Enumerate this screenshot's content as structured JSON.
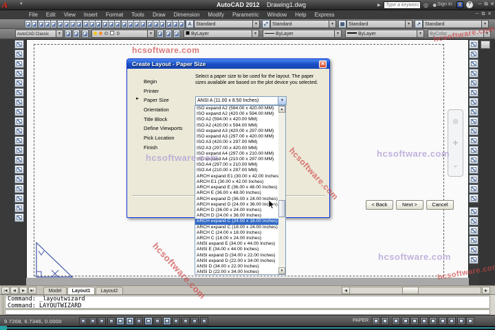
{
  "titlebar": {
    "app": "AutoCAD 2012",
    "doc": "Drawing1.dwg",
    "search_placeholder": "Type a keyword or phrase",
    "sign_in": "Sign In",
    "exchange_glyph": "X",
    "help_glyph": "?"
  },
  "menus": [
    "File",
    "Edit",
    "View",
    "Insert",
    "Format",
    "Tools",
    "Draw",
    "Dimension",
    "Modify",
    "Parametric",
    "Window",
    "Help",
    "Express"
  ],
  "toolbar_row1": {
    "icons": [
      "qnew",
      "open",
      "qsave",
      "plot",
      "plot-preview",
      "publish",
      "3d-print",
      "cut",
      "copy",
      "paste",
      "match-properties",
      "block-editor",
      "undo",
      "undo-list",
      "redo",
      "redo-list",
      "pan-realtime",
      "zoom-realtime",
      "zoom-window",
      "zoom-previous",
      "properties",
      "design-center",
      "tool-palettes",
      "sheet-set-manager",
      "markup-set-manager",
      "quick-calc",
      "help"
    ],
    "style_combos": [
      {
        "name": "text-style",
        "value": "Standard",
        "glyph": "A"
      },
      {
        "name": "dimension-style",
        "value": "Standard",
        "glyph": "⤢"
      },
      {
        "name": "table-style",
        "value": "Standard",
        "glyph": "▦"
      },
      {
        "name": "multileader-style",
        "value": "Standard",
        "glyph": "↗"
      }
    ]
  },
  "toolbar_row2": {
    "workspace": "AutoCAD Classic",
    "workspace_buttons": [
      "workspace-settings",
      "my-workspace"
    ],
    "layer_buttons": [
      "layer-properties-manager"
    ],
    "layer_combo": {
      "name": "0"
    },
    "layer_tool_buttons": [
      "make-object-layer-current",
      "layer-previous",
      "layer-states"
    ],
    "color": "ByLayer",
    "linetype": "ByLayer",
    "lineweight": "ByLayer",
    "plot_style": "ByColor"
  },
  "draw_toolbar": [
    "line",
    "construction-line",
    "polyline",
    "polygon",
    "rectangle",
    "arc",
    "circle",
    "revision-cloud",
    "spline",
    "ellipse",
    "ellipse-arc",
    "insert-block",
    "make-block",
    "point",
    "hatch",
    "gradient",
    "region",
    "table",
    "multiline-text"
  ],
  "modify_toolbar": [
    "erase",
    "copy",
    "mirror",
    "offset",
    "array",
    "move",
    "rotate",
    "scale",
    "stretch",
    "trim",
    "extend",
    "break-at-point",
    "break",
    "join",
    "chamfer",
    "fillet",
    "explode"
  ],
  "draworder_toolbar": [
    "bring-to-front",
    "send-to-back",
    "bring-above-objects",
    "send-under-objects",
    "text-to-front",
    "hatch-to-back"
  ],
  "navbar_icons": [
    "steering-wheel",
    "pan-hand",
    "zoom-extents"
  ],
  "dialog": {
    "title": "Create Layout - Paper Size",
    "close_glyph": "✕",
    "steps": [
      "Begin",
      "Printer",
      "Paper Size",
      "Orientation",
      "Title Block",
      "Define Viewports",
      "Pick Location",
      "Finish"
    ],
    "active_step": "Paper Size",
    "hint_line1": "Select a paper size to be used for the layout.  The paper",
    "hint_line2": "sizes available are based on the plot device you selected.",
    "combo_value": "ANSI A (11.00 x 8.50 Inches)",
    "paper_sizes": [
      "ISO expand A2 (594.00 x 420.00 MM)",
      "ISO expand A2 (420.00 x 594.00 MM)",
      "ISO A2 (594.00 x 420.00 MM)",
      "ISO A2 (420.00 x 594.00 MM)",
      "ISO expand A3 (420.00 x 297.00 MM)",
      "ISO expand A3 (297.00 x 420.00 MM)",
      "ISO A3 (420.00 x 297.00 MM)",
      "ISO A3 (297.00 x 420.00 MM)",
      "ISO expand A4 (297.00 x 210.00 MM)",
      "ISO expand A4 (210.00 x 297.00 MM)",
      "ISO A4 (297.00 x 210.00 MM)",
      "ISO A4 (210.00 x 297.00 MM)",
      "ARCH expand E1 (30.00 x 42.00 Inches)",
      "ARCH E1 (30.00 x 42.00 Inches)",
      "ARCH expand E (36.00 x 48.00 Inches)",
      "ARCH E (36.00 x 48.00 Inches)",
      "ARCH expand D (36.00 x 24.00 Inches)",
      "ARCH expand D (24.00 x 36.00 Inches)",
      "ARCH D (36.00 x 24.00 Inches)",
      "ARCH D (24.00 x 36.00 Inches)",
      "ARCH expand C (24.00 x 18.00 Inches)",
      "ARCH expand C (18.00 x 24.00 Inches)",
      "ARCH C (24.00 x 18.00 Inches)",
      "ARCH C (18.00 x 24.00 Inches)",
      "ANSI expand E (34.00 x 44.00 Inches)",
      "ANSI E (34.00 x 44.00 Inches)",
      "ANSI expand D (34.00 x 22.00 Inches)",
      "ANSI expand D (22.00 x 34.00 Inches)",
      "ANSI D (34.00 x 22.00 Inches)",
      "ANSI D (22.00 x 34.00 Inches)"
    ],
    "selected_paper": "ARCH expand C (24.00 x 18.00 Inches)",
    "buttons": {
      "back": "< Back",
      "next": "Next >",
      "cancel": "Cancel"
    }
  },
  "layout_tabs": {
    "nav_glyphs": [
      "|◀",
      "◀",
      "▶",
      "▶|"
    ],
    "tabs": [
      "Model",
      "Layout1",
      "Layout2"
    ],
    "active": "Layout1"
  },
  "command_window": {
    "lines": [
      "Command: _layoutwizard",
      "Command: LAYOUTWIZARD"
    ]
  },
  "status_bar": {
    "coordinates": "9.7268, 6.7346, 0.0000",
    "toggles": [
      {
        "name": "infer-constraints",
        "active": false
      },
      {
        "name": "snap-mode",
        "active": false
      },
      {
        "name": "grid-display",
        "active": false
      },
      {
        "name": "ortho-mode",
        "active": false
      },
      {
        "name": "polar-tracking",
        "active": true
      },
      {
        "name": "object-snap",
        "active": true
      },
      {
        "name": "3d-object-snap",
        "active": false
      },
      {
        "name": "object-snap-tracking",
        "active": true
      },
      {
        "name": "dynamic-ucs",
        "active": false
      },
      {
        "name": "dynamic-input",
        "active": true
      },
      {
        "name": "lineweight",
        "active": false
      },
      {
        "name": "transparency",
        "active": false
      },
      {
        "name": "quick-properties",
        "active": false
      },
      {
        "name": "selection-cycling",
        "active": false
      }
    ],
    "space_label": "PAPER",
    "space_buttons": [
      "model-or-paper-space",
      "maximize-viewport"
    ],
    "right_icons": [
      "quick-view-layouts",
      "annotation-visibility",
      "annotation-autoscale",
      "workspace-switching",
      "toolbar-lock",
      "hardware-acceleration",
      "isolate-objects",
      "application-status-menu",
      "clean-screen"
    ]
  },
  "watermark": {
    "text": "hcsoftware.com"
  },
  "colors": {
    "accent_blue": "#316ac5",
    "dialog_title": "#1c50c8",
    "watermark_red": "#cd4646",
    "watermark_light": "#b2a0d6",
    "autocad_red": "#d93425"
  }
}
